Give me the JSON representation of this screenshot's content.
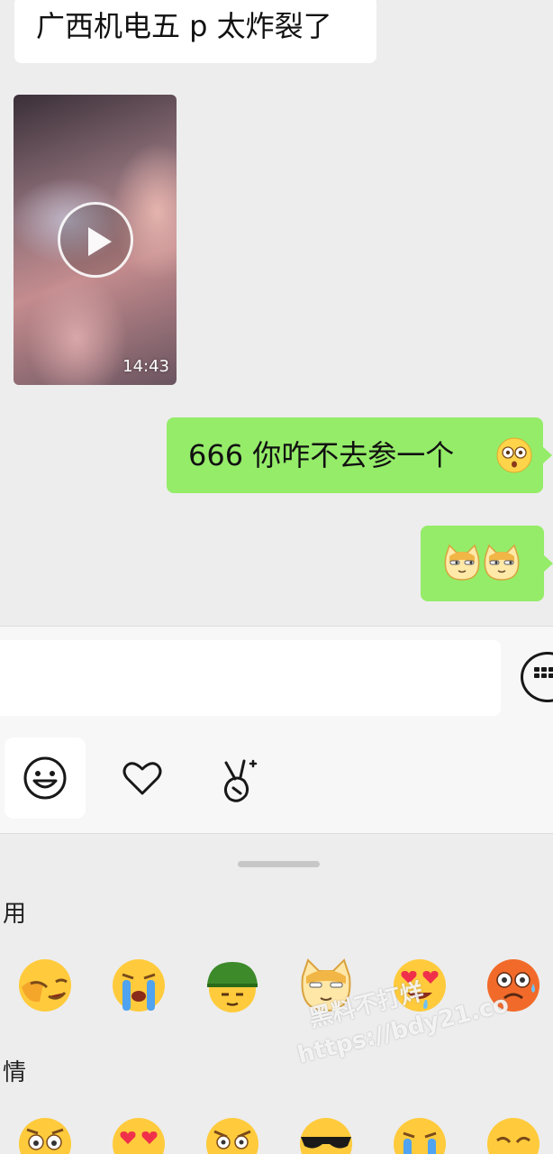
{
  "messages": {
    "incoming_text": "广西机电五 p 太炸裂了",
    "video_duration": "14:43",
    "outgoing_text": "666 你咋不去参一个",
    "outgoing_emoji": "dizzy-face-emoji",
    "outgoing_stickers": [
      "cat-sticker",
      "cat-sticker"
    ]
  },
  "panel": {
    "section_frequent": "用",
    "section_emotion": "情",
    "frequent_icons": [
      "facepalm-laugh-emoji",
      "loudly-crying-emoji",
      "green-helmet-emoji",
      "doge-emoji",
      "heart-eyes-drool-emoji",
      "scared-emoji"
    ],
    "emotion_icons": [
      "dizzy-face-emoji",
      "heart-eyes-emoji",
      "angry-emoji",
      "sunglasses-emoji",
      "loudly-crying-emoji",
      "sly-emoji"
    ]
  },
  "tabs": [
    "emoji-tab",
    "favorites-tab",
    "gestures-tab"
  ],
  "watermark": {
    "line1": "黑料不打烊",
    "line2": "https://bdy21.co"
  },
  "colors": {
    "chat_bg": "#ededed",
    "bubble_out": "#95ec69",
    "bubble_in": "#ffffff"
  }
}
